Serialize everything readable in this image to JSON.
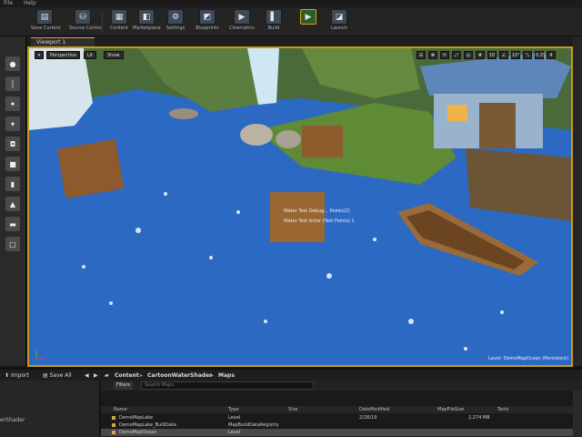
{
  "menubar": {
    "items": [
      "File",
      "Help"
    ]
  },
  "toolbar": {
    "buttons": [
      {
        "label": "Save Current",
        "icon": "save-icon",
        "glyph": "▤"
      },
      {
        "label": "Source Control",
        "icon": "source-control-icon",
        "glyph": "⛁"
      },
      {
        "label": "Content",
        "icon": "content-icon",
        "glyph": "▦"
      },
      {
        "label": "Marketplace",
        "icon": "marketplace-icon",
        "glyph": "◧"
      },
      {
        "label": "Settings",
        "icon": "settings-icon",
        "glyph": "⚙"
      },
      {
        "label": "Blueprints",
        "icon": "blueprints-icon",
        "glyph": "◩"
      },
      {
        "label": "Cinematics",
        "icon": "cinematics-icon",
        "glyph": "▶"
      },
      {
        "label": "Build",
        "icon": "build-icon",
        "glyph": "▌"
      },
      {
        "label": "Play",
        "icon": "play-icon",
        "glyph": "▶"
      },
      {
        "label": "Launch",
        "icon": "launch-icon",
        "glyph": "◪"
      }
    ]
  },
  "viewport": {
    "tab_label": "Viewport 1",
    "perspective_label": "Perspective",
    "lit_label": "Lit",
    "show_label": "Show",
    "tools": [
      "☰",
      "✥",
      "⟳",
      "⤢",
      "◎",
      "#",
      "10",
      "∠",
      "10°",
      "⤡",
      "0.25",
      "4"
    ],
    "annotation_1": "Water Test Debug... Points(2)",
    "annotation_2": "Water Test Actor (Test Points) 1",
    "level_label": "Level: DemoMapOcean (Persistent)"
  },
  "content_browser": {
    "import_label": "Import",
    "save_all_label": "Save All",
    "crumbs": [
      "Content",
      "CartoonWaterShader",
      "Maps"
    ],
    "filters_label": "Filters",
    "search_placeholder": "Search Maps",
    "sources_label": "erShader",
    "columns": [
      "Name",
      "Type",
      "Size",
      "DateModified",
      "MapFileSize",
      "Tests"
    ],
    "rows": [
      {
        "name": "DemoMapLake",
        "type": "Level",
        "date": "2/28/19",
        "mapsize": "2,274 MB"
      },
      {
        "name": "DemoMapLake_BuiltData",
        "type": "MapBuildDataRegistry",
        "date": "",
        "mapsize": ""
      },
      {
        "name": "DemoMapOcean",
        "type": "Level",
        "date": "",
        "mapsize": ""
      }
    ]
  }
}
